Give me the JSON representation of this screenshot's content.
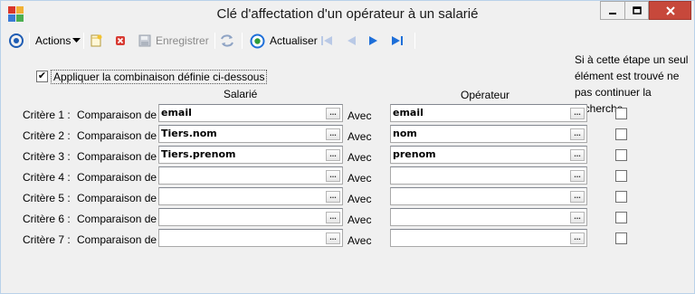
{
  "window": {
    "title": "Clé d'affectation d'un opérateur à un salarié"
  },
  "toolbar": {
    "actions_label": "Actions",
    "save_label": "Enregistrer",
    "refresh_label": "Actualiser"
  },
  "options": {
    "apply_combination_label": "Appliquer la combinaison définie ci-dessous",
    "apply_combination_checked": true
  },
  "headers": {
    "employee": "Salarié",
    "operator": "Opérateur",
    "stop_note": "Si à cette étape un seul élément est trouvé ne pas continuer la recherche"
  },
  "common": {
    "compare_label": "Comparaison de :",
    "with_label": "Avec"
  },
  "criteria": [
    {
      "label": "Critère 1 :",
      "employee_value": "email",
      "operator_value": "email",
      "stop": false
    },
    {
      "label": "Critère 2 :",
      "employee_value": "Tiers.nom",
      "operator_value": "nom",
      "stop": false
    },
    {
      "label": "Critère 3 :",
      "employee_value": "Tiers.prenom",
      "operator_value": "prenom",
      "stop": false
    },
    {
      "label": "Critère 4 :",
      "employee_value": "",
      "operator_value": "",
      "stop": false
    },
    {
      "label": "Critère 5 :",
      "employee_value": "",
      "operator_value": "",
      "stop": false
    },
    {
      "label": "Critère 6 :",
      "employee_value": "",
      "operator_value": "",
      "stop": false
    },
    {
      "label": "Critère 7 :",
      "employee_value": "",
      "operator_value": "",
      "stop": false
    }
  ],
  "icons": {
    "app": "app-icon",
    "menu": "circle-target-icon",
    "new": "new-document-icon",
    "delete": "delete-icon",
    "save": "save-icon",
    "sync": "sync-icon",
    "refresh": "refresh-icon",
    "first": "first-record-icon",
    "prev": "previous-record-icon",
    "next": "next-record-icon",
    "last": "last-record-icon",
    "ellipsis": "ellipsis-icon"
  },
  "colors": {
    "close_button": "#c7483b",
    "nav_active": "#1e6fd9",
    "nav_disabled": "#b9c9e6"
  }
}
